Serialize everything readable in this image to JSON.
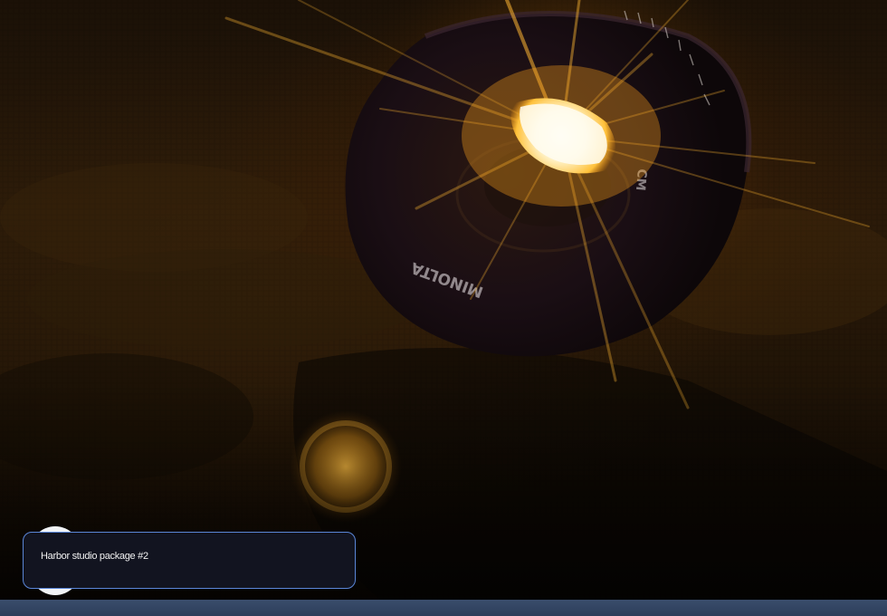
{
  "photo": {
    "subject": "camera-lens-with-sun-flare",
    "lens_brand_text": "MINOLTA",
    "lens_side_text": "CM",
    "colors": {
      "flare_core": "#fff6d8",
      "flare_glow": "#ffb020",
      "lens_body": "#1a0f14",
      "background": "#2a1a09"
    }
  },
  "caption": {
    "title": "Harbor studio package #2"
  },
  "colors": {
    "card_background": "#121420",
    "card_border": "#5a86d8",
    "bottom_bar": "#34476a"
  }
}
